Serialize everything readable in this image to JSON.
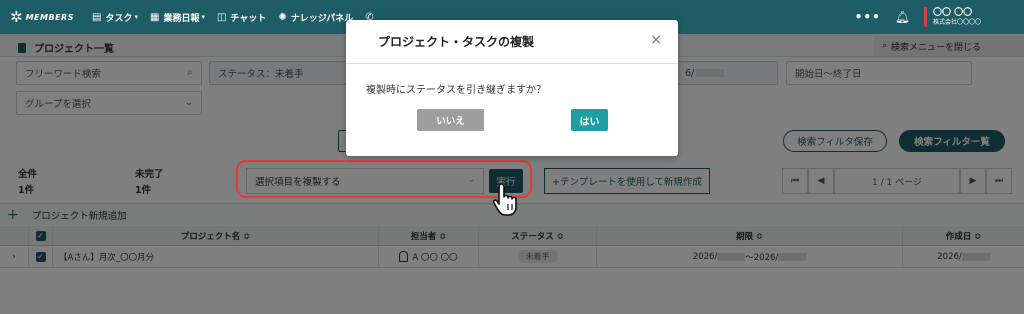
{
  "nav": {
    "logo": "MEMBERS",
    "items": [
      {
        "label": "タスク",
        "icon": "file-icon",
        "caret": true
      },
      {
        "label": "業務日報",
        "icon": "clipboard-icon",
        "caret": true
      },
      {
        "label": "チャット",
        "icon": "chat-icon",
        "caret": false
      },
      {
        "label": "ナレッジパネル",
        "icon": "lightbulb-icon",
        "caret": false
      }
    ],
    "more": "•••",
    "user_name": "〇〇 〇〇",
    "user_company": "株式会社〇〇〇〇"
  },
  "header": {
    "title": "プロジェクト一覧",
    "close_search": "検索メニューを閉じる"
  },
  "search": {
    "freeword_placeholder": "フリーワード検索",
    "status_value": "ステータス：未着手",
    "date_partial": "6/",
    "start_end_placeholder": "開始日〜終了日",
    "group_placeholder": "グループを選択"
  },
  "buttons": {
    "save_filter": "検索フィルタ保存",
    "filter_list": "検索フィルター覧"
  },
  "counts": {
    "all_label": "全件",
    "all_value": "1件",
    "incomplete_label": "未完了",
    "incomplete_value": "1件"
  },
  "bulk": {
    "select_value": "選択項目を複製する",
    "execute": "実行",
    "template_new": "+テンプレートを使用して新規作成"
  },
  "pager": {
    "first": "⏮",
    "prev": "◀",
    "page_text": "1 / 1 ページ",
    "next": "▶",
    "last": "⏭"
  },
  "add_row": "プロジェクト新規追加",
  "table": {
    "headers": {
      "name": "プロジェクト名 ≎",
      "assignee": "担当者 ≎",
      "status": "ステータス ≎",
      "deadline": "期限 ≎",
      "created": "作成日 ≎"
    },
    "rows": [
      {
        "name": "【Aさん】月次_〇〇月分",
        "assignee": "A 〇〇 〇〇",
        "status": "未着手",
        "deadline_a": "2026/",
        "deadline_sep": "〜2026/",
        "created": "2026/"
      }
    ]
  },
  "modal": {
    "title": "プロジェクト・タスクの複製",
    "close": "×",
    "message": "複製時にステータスを引き継ぎますか？",
    "no": "いいえ",
    "yes": "はい"
  }
}
